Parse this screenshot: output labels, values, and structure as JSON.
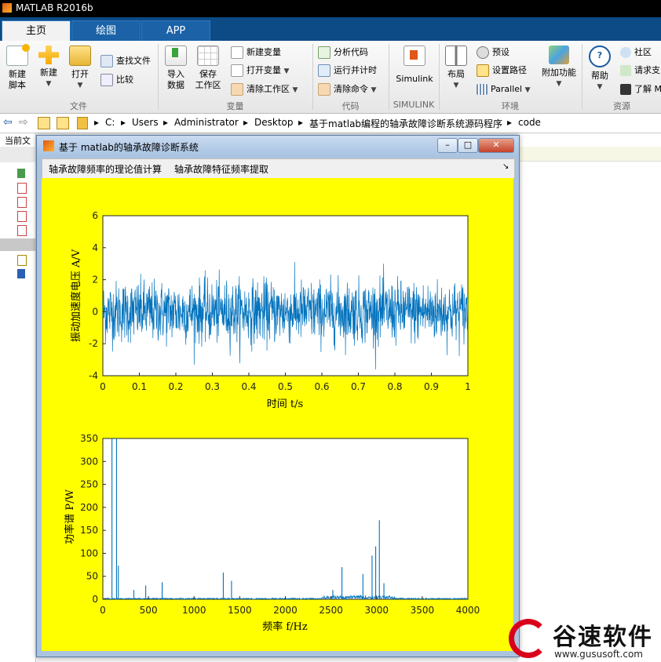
{
  "app": {
    "title": "MATLAB R2016b"
  },
  "tabs": [
    "主页",
    "绘图",
    "APP"
  ],
  "ribbon": {
    "new_script": [
      "新建",
      "脚本"
    ],
    "new": "新建",
    "open": "打开",
    "find_files": "查找文件",
    "compare": "比较",
    "import_data": [
      "导入",
      "数据"
    ],
    "save_workspace": [
      "保存",
      "工作区"
    ],
    "new_variable": "新建变量",
    "open_variable": "打开变量",
    "clear_workspace": "清除工作区",
    "analyze_code": "分析代码",
    "run_and_time": "运行并计时",
    "clear_commands": "清除命令",
    "simulink": "Simulink",
    "layout": "布局",
    "preferences": "预设",
    "set_path": "设置路径",
    "parallel": "Parallel",
    "addons": "附加功能",
    "help": "帮助",
    "community": "社区",
    "request_support": "请求支",
    "learn": "了解 M",
    "groups": {
      "file": "文件",
      "variable": "变量",
      "code": "代码",
      "simulink": "SIMULINK",
      "environment": "环境",
      "resources": "资源"
    }
  },
  "address": {
    "crumbs": [
      "C:",
      "Users",
      "Administrator",
      "Desktop",
      "基于matlab编程的轴承故障诊断系统源码程序",
      "code"
    ]
  },
  "left_panel": {
    "title": "当前文"
  },
  "figure": {
    "title": "基于 matlab的轴承故障诊断系统",
    "menu": [
      "轴承故障频率的理论值计算",
      "轴承故障特征频率提取"
    ]
  },
  "chart_data": [
    {
      "type": "line",
      "title": "",
      "xlabel": "时间 t/s",
      "ylabel": "振动加速度电压 A/V",
      "xlim": [
        0,
        1
      ],
      "ylim": [
        -4,
        6
      ],
      "xticks": [
        "0",
        "0.1",
        "0.2",
        "0.3",
        "0.4",
        "0.5",
        "0.6",
        "0.7",
        "0.8",
        "0.9",
        "1"
      ],
      "yticks": [
        "-4",
        "-2",
        "0",
        "2",
        "4",
        "6"
      ],
      "series": [
        {
          "color": "#0072bd",
          "description_values": "dense random noise, amplitude roughly -3.5 to 4, full span 0 to 1 s"
        }
      ]
    },
    {
      "type": "line",
      "title": "",
      "xlabel": "频率 f/Hz",
      "ylabel": "功率谱 P/W",
      "xlim": [
        0,
        4000
      ],
      "ylim": [
        0,
        350
      ],
      "xticks": [
        "0",
        "500",
        "1000",
        "1500",
        "2000",
        "2500",
        "3000",
        "3500",
        "4000"
      ],
      "yticks": [
        "0",
        "50",
        "100",
        "150",
        "200",
        "250",
        "300",
        "350"
      ],
      "peaks": [
        {
          "x": 100,
          "y": 350
        },
        {
          "x": 150,
          "y": 350
        },
        {
          "x": 170,
          "y": 73
        },
        {
          "x": 340,
          "y": 20
        },
        {
          "x": 470,
          "y": 30
        },
        {
          "x": 650,
          "y": 37
        },
        {
          "x": 1320,
          "y": 58
        },
        {
          "x": 1410,
          "y": 40
        },
        {
          "x": 2520,
          "y": 20
        },
        {
          "x": 2620,
          "y": 70
        },
        {
          "x": 2850,
          "y": 55
        },
        {
          "x": 2950,
          "y": 95
        },
        {
          "x": 2990,
          "y": 115
        },
        {
          "x": 3030,
          "y": 172
        },
        {
          "x": 3080,
          "y": 35
        }
      ],
      "color": "#0072bd"
    }
  ],
  "watermark": {
    "brand": "谷速软件",
    "url": "www.gususoft.com"
  }
}
